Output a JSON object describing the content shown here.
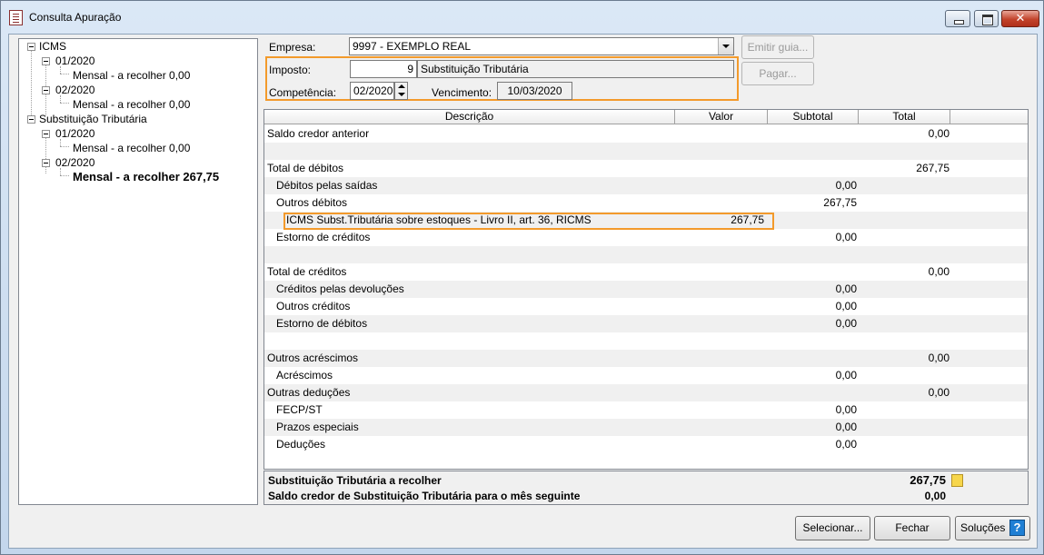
{
  "window": {
    "title": "Consulta Apuração"
  },
  "tree": {
    "nodes": [
      {
        "label": "ICMS"
      },
      {
        "label": "01/2020"
      },
      {
        "label": "Mensal - a recolher 0,00"
      },
      {
        "label": "02/2020"
      },
      {
        "label": "Mensal - a recolher 0,00"
      },
      {
        "label": "Substituição Tributária"
      },
      {
        "label": "01/2020"
      },
      {
        "label": "Mensal - a recolher 0,00"
      },
      {
        "label": "02/2020"
      },
      {
        "label": "Mensal - a recolher 267,75"
      }
    ]
  },
  "form": {
    "empresa_label": "Empresa:",
    "empresa_value": "9997 - EXEMPLO REAL",
    "imposto_label": "Imposto:",
    "imposto_code": "9",
    "imposto_desc": "Substituição Tributária",
    "competencia_label": "Competência:",
    "competencia_value": "02/2020",
    "vencimento_label": "Vencimento:",
    "vencimento_value": "10/03/2020"
  },
  "buttons": {
    "emitir_guia": "Emitir guia...",
    "pagar": "Pagar...",
    "selecionar": "Selecionar...",
    "fechar": "Fechar",
    "solucoes": "Soluções"
  },
  "grid": {
    "headers": [
      "Descrição",
      "Valor",
      "Subtotal",
      "Total"
    ],
    "rows": [
      {
        "desc": "Saldo credor anterior",
        "indent": 0,
        "valor": "",
        "subtotal": "",
        "total": "0,00"
      },
      {
        "desc": "",
        "indent": 0,
        "valor": "",
        "subtotal": "",
        "total": ""
      },
      {
        "desc": "Total de débitos",
        "indent": 0,
        "valor": "",
        "subtotal": "",
        "total": "267,75"
      },
      {
        "desc": "Débitos pelas saídas",
        "indent": 1,
        "valor": "",
        "subtotal": "0,00",
        "total": ""
      },
      {
        "desc": "Outros débitos",
        "indent": 1,
        "valor": "",
        "subtotal": "267,75",
        "total": ""
      },
      {
        "desc": "ICMS Subst.Tributária sobre estoques - Livro II, art. 36, RICMS",
        "indent": 2,
        "valor": "267,75",
        "subtotal": "",
        "total": ""
      },
      {
        "desc": "Estorno de créditos",
        "indent": 1,
        "valor": "",
        "subtotal": "0,00",
        "total": ""
      },
      {
        "desc": "",
        "indent": 0,
        "valor": "",
        "subtotal": "",
        "total": ""
      },
      {
        "desc": "Total de créditos",
        "indent": 0,
        "valor": "",
        "subtotal": "",
        "total": "0,00"
      },
      {
        "desc": "Créditos pelas devoluções",
        "indent": 1,
        "valor": "",
        "subtotal": "0,00",
        "total": ""
      },
      {
        "desc": "Outros créditos",
        "indent": 1,
        "valor": "",
        "subtotal": "0,00",
        "total": ""
      },
      {
        "desc": "Estorno de débitos",
        "indent": 1,
        "valor": "",
        "subtotal": "0,00",
        "total": ""
      },
      {
        "desc": "",
        "indent": 0,
        "valor": "",
        "subtotal": "",
        "total": ""
      },
      {
        "desc": "Outros acréscimos",
        "indent": 0,
        "valor": "",
        "subtotal": "",
        "total": "0,00"
      },
      {
        "desc": "Acréscimos",
        "indent": 1,
        "valor": "",
        "subtotal": "0,00",
        "total": ""
      },
      {
        "desc": "Outras deduções",
        "indent": 0,
        "valor": "",
        "subtotal": "",
        "total": "0,00"
      },
      {
        "desc": "FECP/ST",
        "indent": 1,
        "valor": "",
        "subtotal": "0,00",
        "total": ""
      },
      {
        "desc": "Prazos especiais",
        "indent": 1,
        "valor": "",
        "subtotal": "0,00",
        "total": ""
      },
      {
        "desc": "Deduções",
        "indent": 1,
        "valor": "",
        "subtotal": "0,00",
        "total": ""
      }
    ]
  },
  "summary": {
    "line1_label": "Substituição Tributária a recolher",
    "line1_value": "267,75",
    "line2_label": "Saldo credor de Substituição Tributária para o mês seguinte",
    "line2_value": "0,00"
  },
  "colors": {
    "highlight": "#f39a2b",
    "help": "#1f7fd4"
  }
}
